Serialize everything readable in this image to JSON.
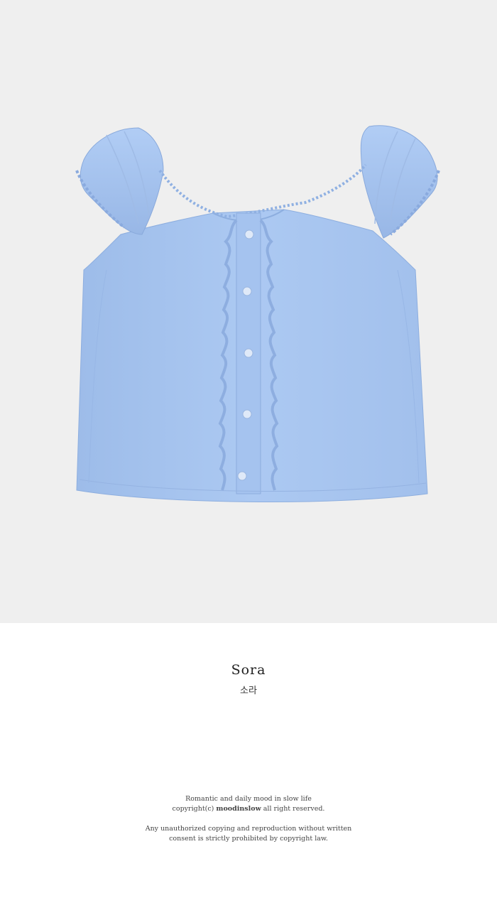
{
  "product_photo": {
    "background": "#efefef",
    "garment_color": "#a9c6f1",
    "icon": "ruffle-top-illustration"
  },
  "product": {
    "name": "Sora",
    "name_ko": "소라"
  },
  "footer": {
    "line1": "Romantic and daily mood in slow life",
    "line2_prefix": "copyright(c) ",
    "line2_brand": "moodinslow",
    "line2_suffix": " all right reserved.",
    "line3": "Any unauthorized copying and reproduction without written",
    "line4": "consent is strictly prohibited by copyright law."
  }
}
